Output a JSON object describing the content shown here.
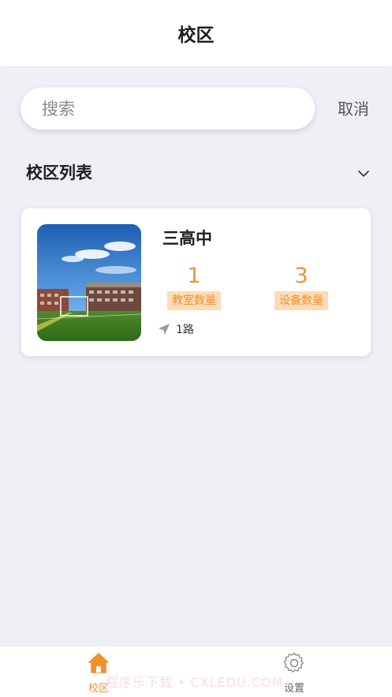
{
  "header": {
    "title": "校区"
  },
  "search": {
    "placeholder": "搜索",
    "value": "",
    "cancel_label": "取消"
  },
  "section": {
    "title": "校区列表"
  },
  "campuses": [
    {
      "name": "三高中",
      "classroom_count": "1",
      "classroom_label": "教室数量",
      "device_count": "3",
      "device_label": "设备数量",
      "route": "1路"
    }
  ],
  "tabbar": {
    "items": [
      {
        "label": "校区",
        "icon": "home-icon",
        "active": true
      },
      {
        "label": "设置",
        "icon": "gear-icon",
        "active": false
      }
    ]
  },
  "watermark": "程序乐下载 • CXLEDU.COM",
  "colors": {
    "accent": "#f0922c",
    "accent_light": "#fcdcb8",
    "background": "#eff0f5"
  }
}
